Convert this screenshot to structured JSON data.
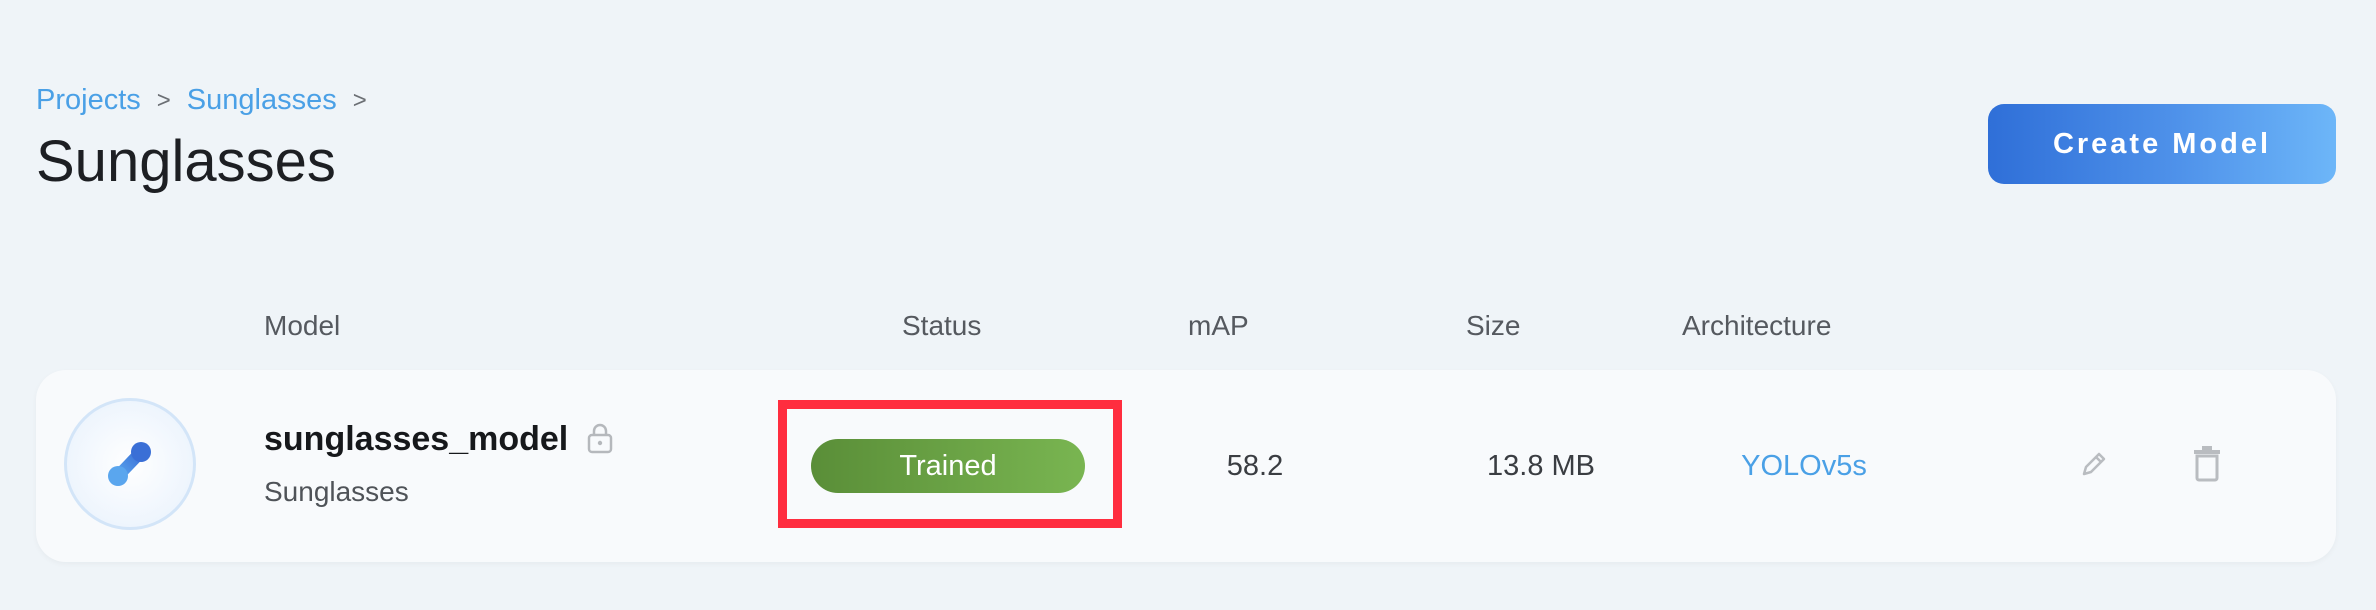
{
  "breadcrumb": {
    "items": [
      "Projects",
      "Sunglasses"
    ],
    "separator": ">"
  },
  "page": {
    "title": "Sunglasses"
  },
  "actions": {
    "create_model_label": "Create Model"
  },
  "table": {
    "columns": [
      "Model",
      "Status",
      "mAP",
      "Size",
      "Architecture"
    ],
    "rows": [
      {
        "model_name": "sunglasses_model",
        "project": "Sunglasses",
        "status": "Trained",
        "map": "58.2",
        "size": "13.8 MB",
        "architecture": "YOLOv5s",
        "icons": [
          "model-avatar-icon",
          "lock-icon",
          "edit-icon",
          "trash-icon"
        ]
      }
    ]
  },
  "colors": {
    "accent": "#4aa0e6",
    "status_trained": "#6aa544",
    "highlight": "#ff2d3f",
    "background": "#eff4f8"
  }
}
